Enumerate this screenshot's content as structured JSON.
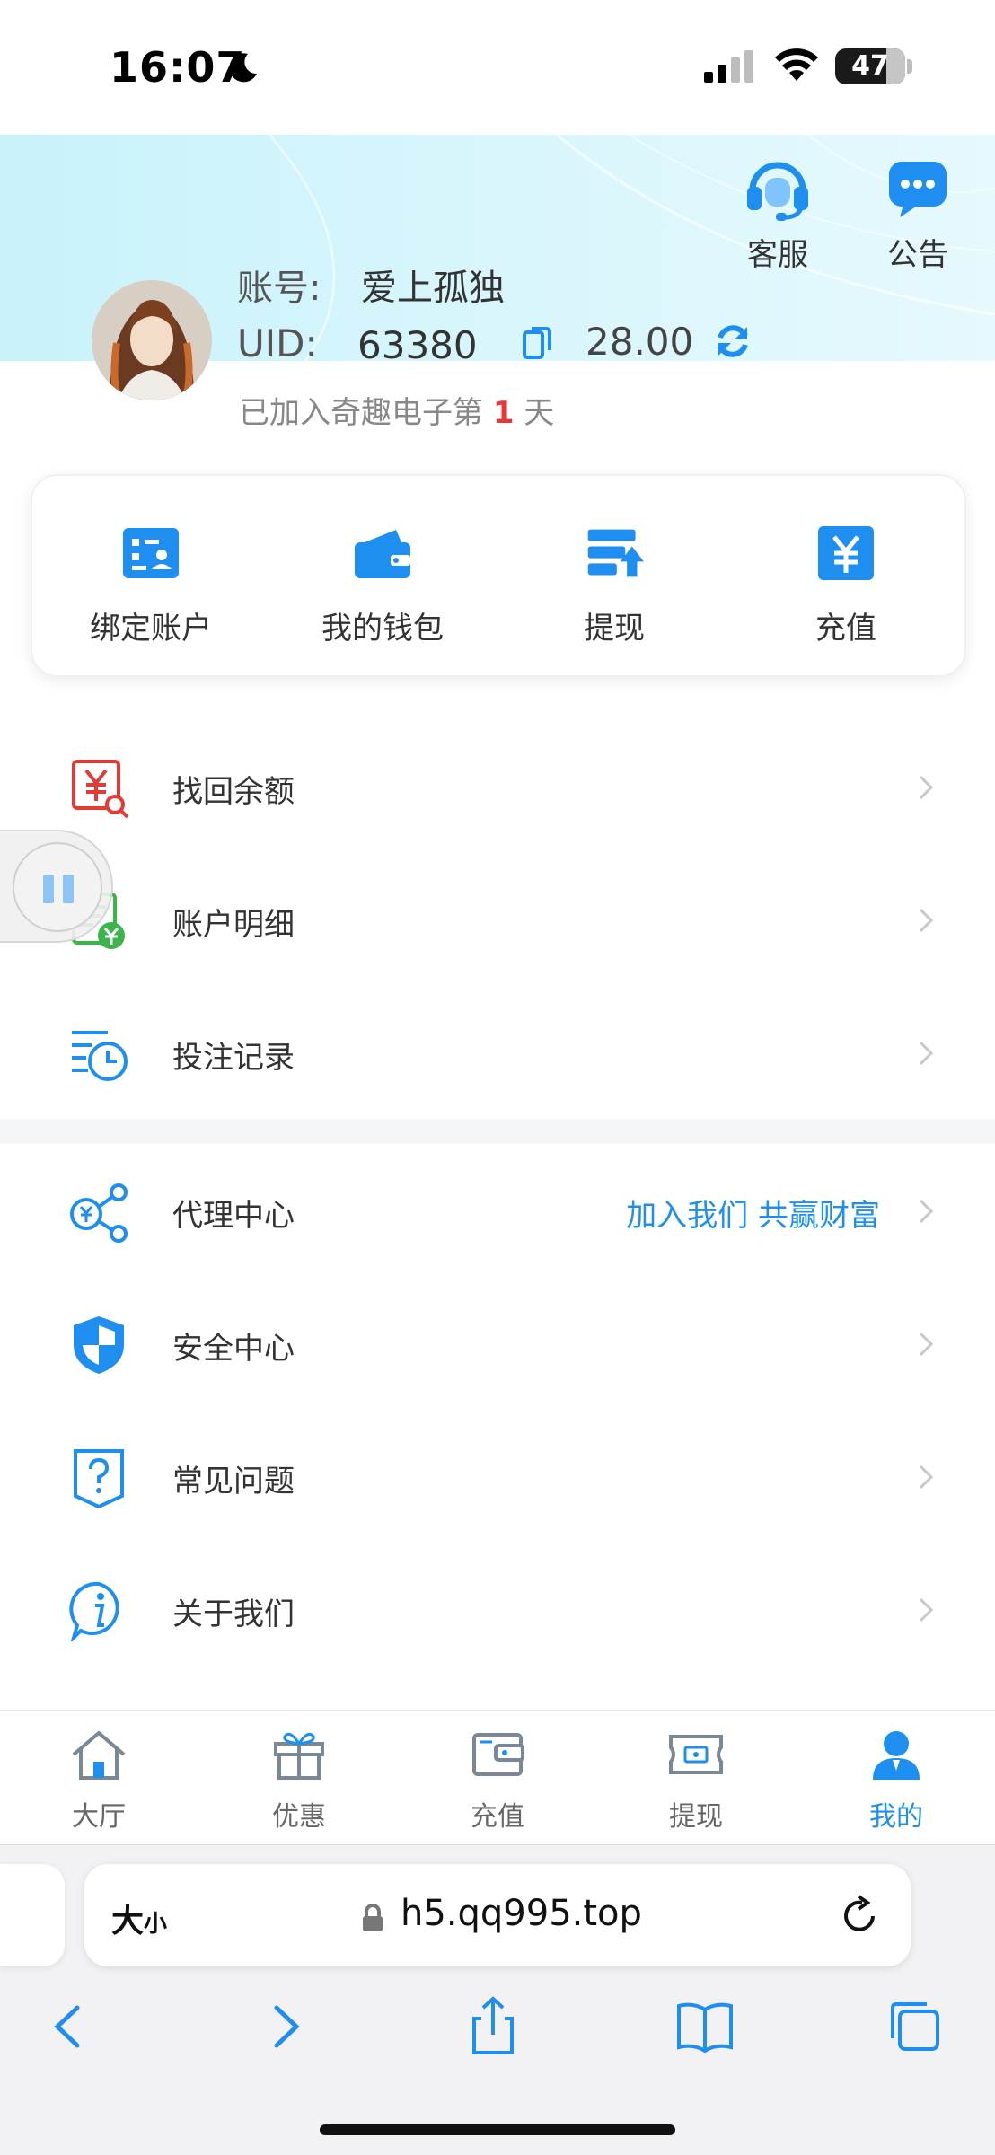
{
  "status_bar": {
    "time": "16:07",
    "battery": "47",
    "battery_level": 0.47
  },
  "header": {
    "service_label": "客服",
    "notice_label": "公告",
    "account_label": "账号:",
    "account_name": "爱上孤独",
    "uid_label": "UID:",
    "uid_value": "63380",
    "balance": "28.00",
    "join_prefix": "已加入奇趣电子第",
    "join_days": "1",
    "join_suffix": "天"
  },
  "quick_actions": [
    {
      "label": "绑定账户",
      "icon": "bind-account-icon"
    },
    {
      "label": "我的钱包",
      "icon": "wallet-icon"
    },
    {
      "label": "提现",
      "icon": "withdraw-icon"
    },
    {
      "label": "充值",
      "icon": "recharge-icon"
    }
  ],
  "menu_group_1": [
    {
      "label": "找回余额",
      "icon": "recover-balance-icon"
    },
    {
      "label": "账户明细",
      "icon": "account-detail-icon"
    },
    {
      "label": "投注记录",
      "icon": "bet-record-icon"
    }
  ],
  "menu_group_2": [
    {
      "label": "代理中心",
      "icon": "agent-center-icon",
      "extra": "加入我们 共赢财富"
    },
    {
      "label": "安全中心",
      "icon": "security-shield-icon"
    },
    {
      "label": "常见问题",
      "icon": "faq-icon"
    },
    {
      "label": "关于我们",
      "icon": "info-icon"
    }
  ],
  "tabbar": [
    {
      "label": "大厅",
      "icon": "home-icon",
      "active": false
    },
    {
      "label": "优惠",
      "icon": "gift-icon",
      "active": false
    },
    {
      "label": "充值",
      "icon": "recharge-tab-icon",
      "active": false
    },
    {
      "label": "提现",
      "icon": "withdraw-tab-icon",
      "active": false
    },
    {
      "label": "我的",
      "icon": "profile-icon",
      "active": true
    }
  ],
  "browser": {
    "text_size_label": "大",
    "text_size_small": "小",
    "url": "h5.qq995.top"
  },
  "colors": {
    "accent": "#1f8ef1",
    "highlight_red": "#e53935"
  }
}
